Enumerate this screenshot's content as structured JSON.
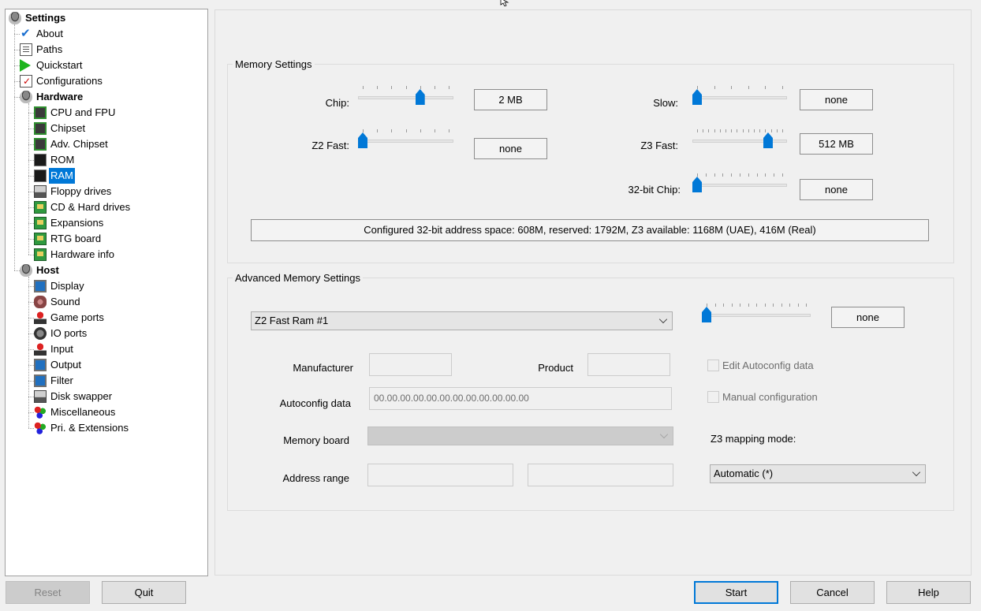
{
  "tree": {
    "root": "Settings",
    "items": [
      {
        "label": "About",
        "icon": "checkmark-icon"
      },
      {
        "label": "Paths",
        "icon": "document-icon"
      },
      {
        "label": "Quickstart",
        "icon": "play-icon"
      },
      {
        "label": "Configurations",
        "icon": "config-icon"
      }
    ],
    "hardware": {
      "label": "Hardware",
      "items": [
        {
          "label": "CPU and FPU",
          "icon": "chip-icon"
        },
        {
          "label": "Chipset",
          "icon": "chip-icon"
        },
        {
          "label": "Adv. Chipset",
          "icon": "chip-icon"
        },
        {
          "label": "ROM",
          "icon": "rom-icon"
        },
        {
          "label": "RAM",
          "icon": "ram-icon",
          "selected": true
        },
        {
          "label": "Floppy drives",
          "icon": "floppy-icon"
        },
        {
          "label": "CD & Hard drives",
          "icon": "board-icon"
        },
        {
          "label": "Expansions",
          "icon": "board-icon"
        },
        {
          "label": "RTG board",
          "icon": "board-icon"
        },
        {
          "label": "Hardware info",
          "icon": "board-icon"
        }
      ]
    },
    "host": {
      "label": "Host",
      "items": [
        {
          "label": "Display",
          "icon": "monitor-icon"
        },
        {
          "label": "Sound",
          "icon": "sound-icon"
        },
        {
          "label": "Game ports",
          "icon": "joystick-icon"
        },
        {
          "label": "IO ports",
          "icon": "network-icon"
        },
        {
          "label": "Input",
          "icon": "joystick-icon"
        },
        {
          "label": "Output",
          "icon": "monitor-icon"
        },
        {
          "label": "Filter",
          "icon": "monitor-icon"
        },
        {
          "label": "Disk swapper",
          "icon": "floppy-icon"
        },
        {
          "label": "Miscellaneous",
          "icon": "balls-icon"
        },
        {
          "label": "Pri. & Extensions",
          "icon": "balls-icon"
        }
      ]
    }
  },
  "memory": {
    "title": "Memory Settings",
    "chip": {
      "label": "Chip:",
      "value": "2 MB",
      "position": 0.667
    },
    "z2fast": {
      "label": "Z2 Fast:",
      "value": "none",
      "position": 0
    },
    "slow": {
      "label": "Slow:",
      "value": "none",
      "position": 0
    },
    "z3fast": {
      "label": "Z3 Fast:",
      "value": "512 MB",
      "position": 0.833
    },
    "chip32": {
      "label": "32-bit Chip:",
      "value": "none",
      "position": 0
    },
    "info": "Configured 32-bit address space: 608M, reserved: 1792M, Z3 available: 1168M (UAE), 416M (Real)"
  },
  "advanced": {
    "title": "Advanced Memory Settings",
    "board_select": "Z2 Fast Ram #1",
    "board_value": "none",
    "board_position": 0,
    "manufacturer_label": "Manufacturer",
    "product_label": "Product",
    "autoconfig_label": "Autoconfig data",
    "autoconfig_value": "00.00.00.00.00.00.00.00.00.00.00.00",
    "memory_board_label": "Memory board",
    "address_range_label": "Address range",
    "edit_autoconfig": "Edit Autoconfig data",
    "manual_config": "Manual configuration",
    "z3_mapping_label": "Z3 mapping mode:",
    "z3_mapping_value": "Automatic (*)"
  },
  "buttons": {
    "reset": "Reset",
    "quit": "Quit",
    "start": "Start",
    "cancel": "Cancel",
    "help": "Help"
  },
  "colors": {
    "accent": "#0078d7",
    "selection": "#0078d7"
  }
}
